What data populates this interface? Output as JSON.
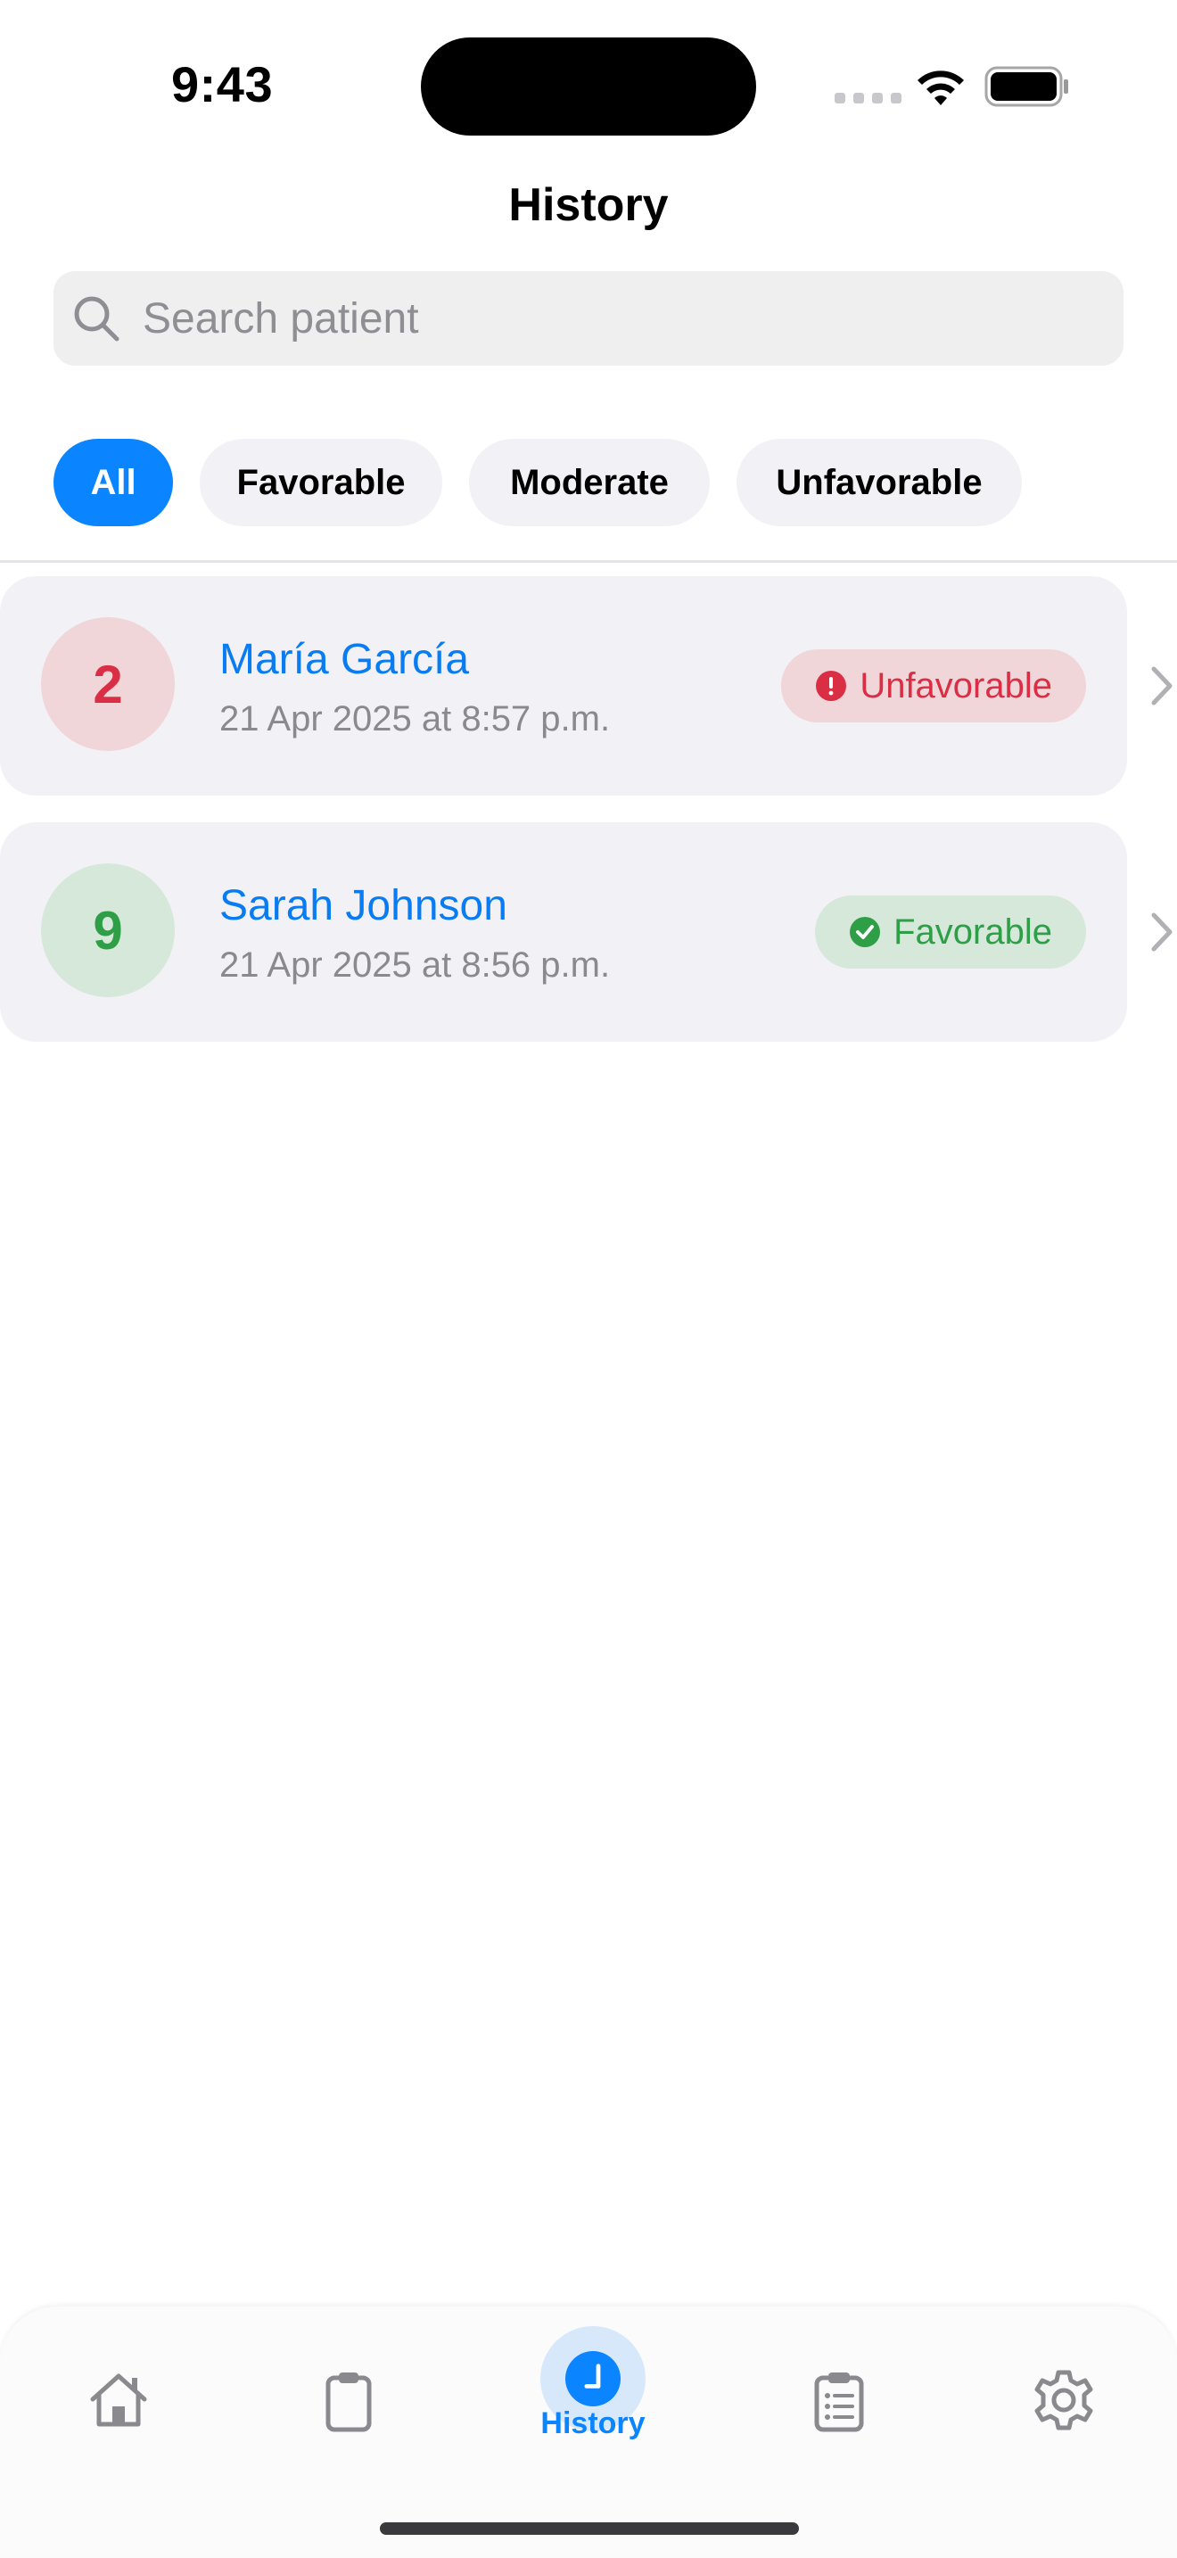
{
  "status_bar": {
    "time": "9:43"
  },
  "nav": {
    "title": "History"
  },
  "search": {
    "placeholder": "Search patient",
    "value": ""
  },
  "filters": [
    {
      "label": "All",
      "active": true
    },
    {
      "label": "Favorable",
      "active": false
    },
    {
      "label": "Moderate",
      "active": false
    },
    {
      "label": "Unfavorable",
      "active": false
    }
  ],
  "patients": [
    {
      "score": "2",
      "name": "María García",
      "date": "21 Apr 2025 at 8:57 p.m.",
      "status": "Unfavorable",
      "status_color": "#d92e44"
    },
    {
      "score": "9",
      "name": "Sarah Johnson",
      "date": "21 Apr 2025 at 8:56 p.m.",
      "status": "Favorable",
      "status_color": "#2e9e47"
    }
  ],
  "tabbar": {
    "items": [
      {
        "icon": "home-icon",
        "active": false
      },
      {
        "icon": "clipboard-icon",
        "active": false
      },
      {
        "icon": "clock-icon",
        "label": "History",
        "active": true
      },
      {
        "icon": "list-clipboard-icon",
        "active": false
      },
      {
        "icon": "gear-icon",
        "active": false
      }
    ]
  },
  "colors": {
    "accent": "#0a84ff",
    "name_link": "#0a7cf2",
    "unfavorable": "#d92e44",
    "favorable": "#2e9e47"
  }
}
